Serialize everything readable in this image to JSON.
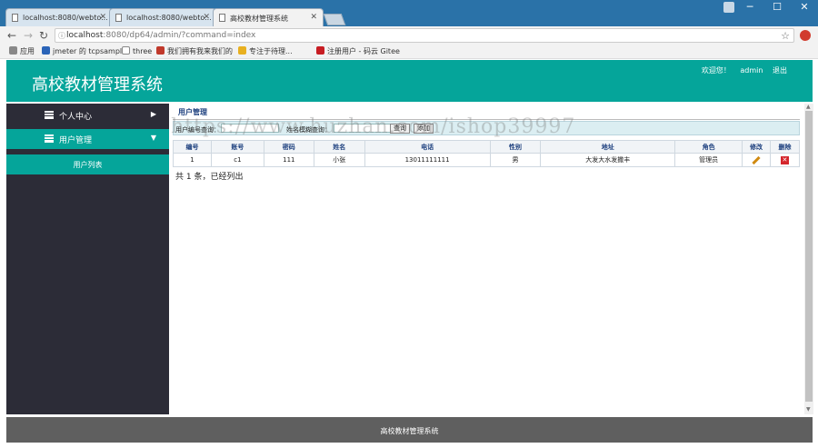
{
  "browser": {
    "tabs": [
      {
        "title": "localhost:8080/webto..."
      },
      {
        "title": "localhost:8080/webto..."
      },
      {
        "title": "高校教材管理系统"
      }
    ],
    "url_host": "localhost",
    "url_rest": ":8080/dp64/admin/?command=index",
    "bookmarks": [
      "应用",
      "jmeter 的 tcpsample",
      "three",
      "我们拥有我来我们的",
      "专注于待理...",
      "注册用户 - 码云 Gitee"
    ]
  },
  "app": {
    "title": "高校教材管理系统",
    "welcome": "欢迎您！",
    "username": "admin",
    "logout": "退出",
    "footer": "高校教材管理系统"
  },
  "sidebar": {
    "items": [
      {
        "label": "个人中心"
      },
      {
        "label": "用户管理"
      }
    ],
    "sub_item": "用户列表"
  },
  "main": {
    "page_title": "用户管理",
    "search": {
      "label1": "用户编号查询：",
      "label2": "姓名模糊查询：",
      "query_btn": "查询",
      "add_btn": "添加"
    },
    "columns": [
      "编号",
      "账号",
      "密码",
      "姓名",
      "电话",
      "性别",
      "地址",
      "角色",
      "修改",
      "删除"
    ],
    "rows": [
      [
        "1",
        "c1",
        "111",
        "小张",
        "13011111111",
        "男",
        "大发大水发撒丰",
        "管理员"
      ]
    ],
    "total": "共 1 条，已经列出"
  },
  "watermark": "https://www.huzhan.com/ishop39997",
  "colors": {
    "accent": "#05a59a",
    "sidebar": "#2c2c37",
    "footer": "#5f5f5f"
  }
}
